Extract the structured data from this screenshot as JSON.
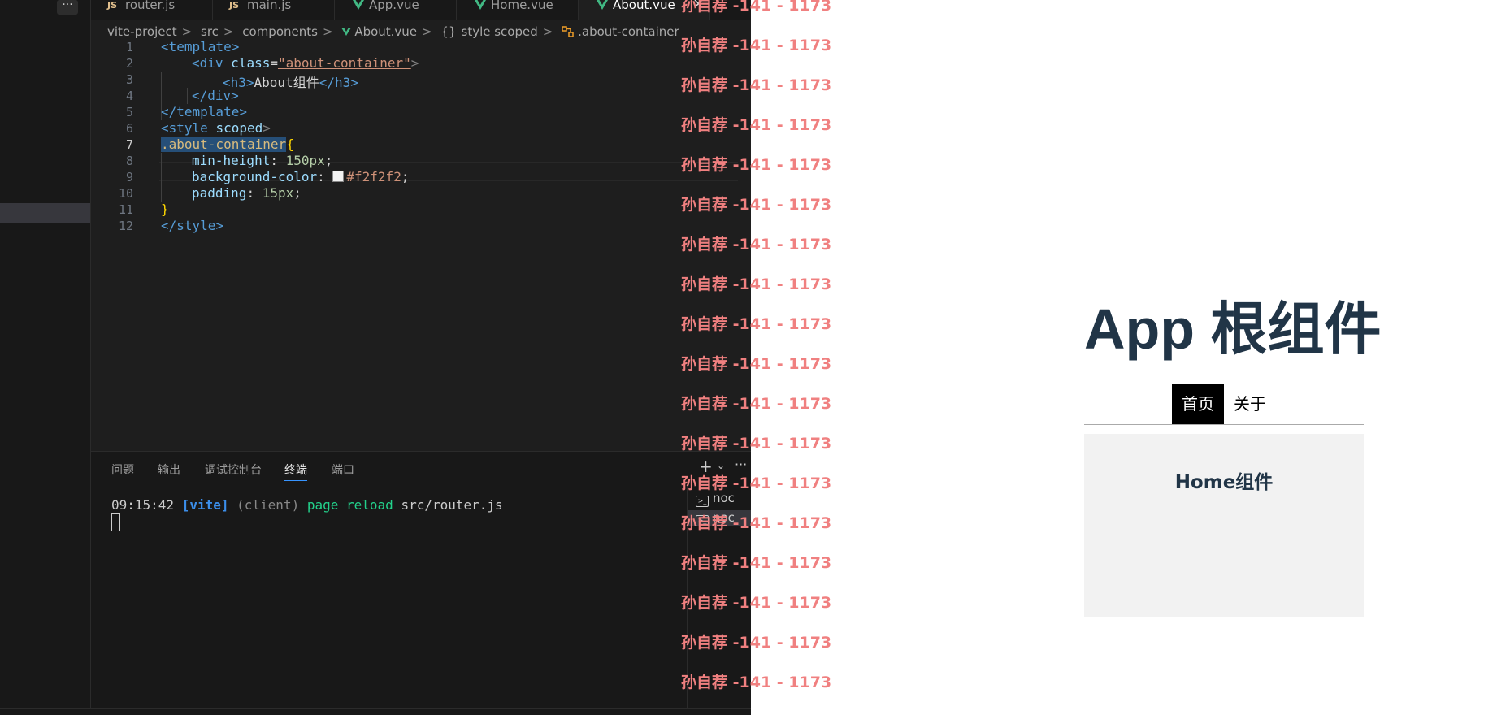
{
  "sidebar": {
    "more_label": "···"
  },
  "tabs": [
    {
      "kind": "JS",
      "label": "router.js"
    },
    {
      "kind": "JS",
      "label": "main.js"
    },
    {
      "kind": "vue",
      "label": "App.vue"
    },
    {
      "kind": "vue",
      "label": "Home.vue"
    },
    {
      "kind": "vue",
      "label": "About.vue",
      "active": true,
      "close": "×"
    }
  ],
  "breadcrumb": [
    "vite-project",
    "src",
    "components",
    "About.vue",
    "style scoped",
    ".about-container"
  ],
  "breadcrumb_icons": {
    "style": "{}",
    "sep": ">"
  },
  "editor": {
    "current_line": 7,
    "lines": [
      {
        "n": "1"
      },
      {
        "n": "2"
      },
      {
        "n": "3"
      },
      {
        "n": "4"
      },
      {
        "n": "5"
      },
      {
        "n": "6"
      },
      {
        "n": "7"
      },
      {
        "n": "8"
      },
      {
        "n": "9"
      },
      {
        "n": "10"
      },
      {
        "n": "11"
      },
      {
        "n": "12"
      }
    ],
    "tokens": {
      "template_open": "<template>",
      "div_open_a": "<div ",
      "div_class_attr": "class",
      "div_eq": "=",
      "div_class_val": "\"about-container\"",
      "div_open_b": ">",
      "h3_open": "<h3>",
      "h3_text": "About组件",
      "h3_close": "</h3>",
      "div_close": "</div>",
      "template_close": "</template>",
      "style_open_a": "<style ",
      "style_attr": "scoped",
      "style_open_b": ">",
      "selector": ".about-container",
      "brace_open": "{",
      "prop1": "min-height",
      "val1": "150px",
      "prop2": "background-color",
      "val2": "#f2f2f2",
      "prop3": "padding",
      "val3": "15px",
      "colon": ": ",
      "semi": ";",
      "brace_close": "}",
      "style_close": "</style>"
    }
  },
  "panel": {
    "tabs": [
      "问题",
      "输出",
      "调试控制台",
      "终端",
      "端口"
    ],
    "active_tab": "终端",
    "actions": {
      "add": "+",
      "chevron": "⌄",
      "more": "···"
    },
    "terminal": {
      "time": "09:15:42",
      "tag": "[vite]",
      "scope": "(client)",
      "msg": "page reload",
      "file": "src/router.js"
    },
    "terminal_list": [
      "noc",
      "noc"
    ]
  },
  "watermark": {
    "text": "孙自荐 -141 - 1173",
    "count": 18
  },
  "app": {
    "title": "App 根组件",
    "nav": [
      {
        "label": "首页",
        "active": true
      },
      {
        "label": "关于"
      }
    ],
    "content_heading": "Home组件"
  },
  "colors": {
    "editor_bg": "#1e1e1e",
    "watermark": "#f08080",
    "app_title": "#213547",
    "content_bg": "#f2f2f2"
  }
}
